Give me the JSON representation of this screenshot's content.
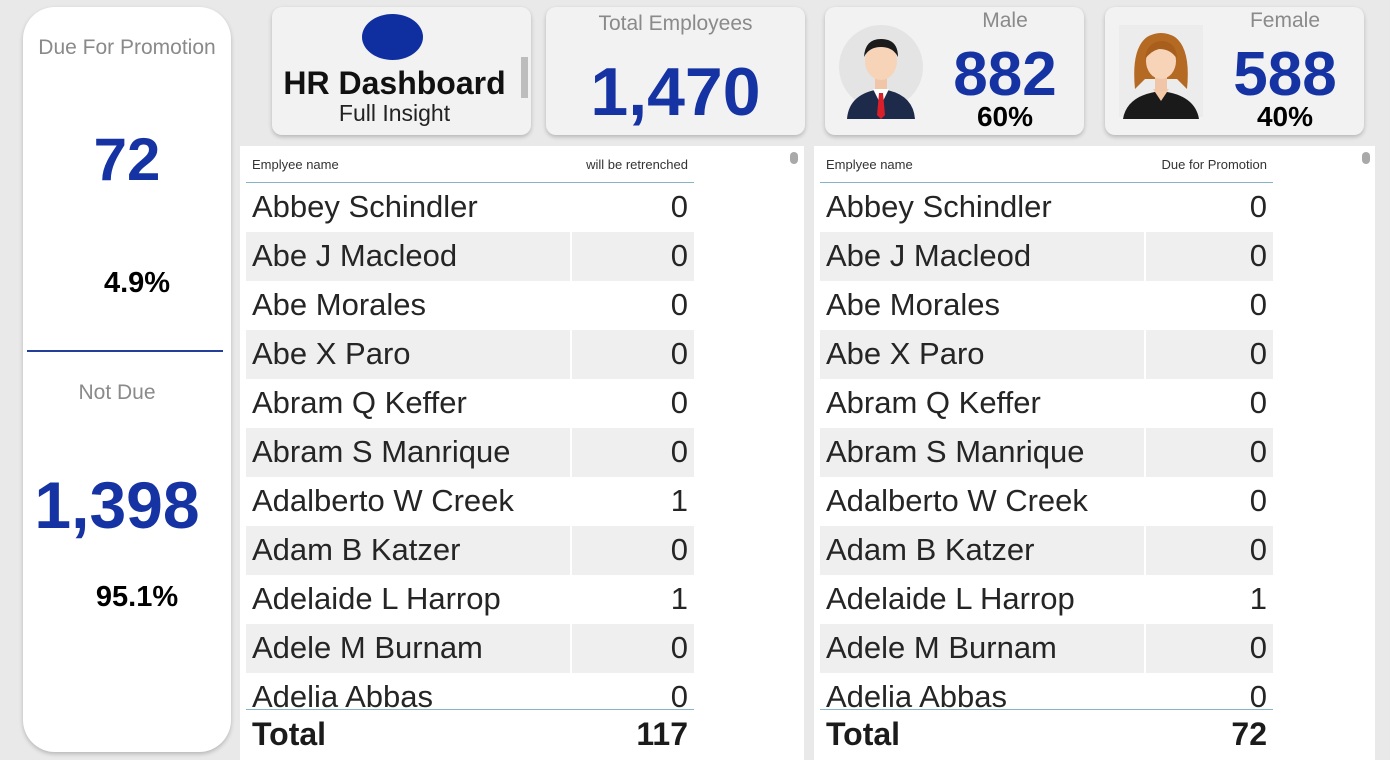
{
  "promotion_card": {
    "title": "Due For Promotion",
    "due_count": "72",
    "due_pct": "4.9%",
    "not_due_label": "Not Due",
    "not_due_count": "1,398",
    "not_due_pct": "95.1%"
  },
  "title_card": {
    "title": "HR Dashboard",
    "subtitle": "Full Insight"
  },
  "total_card": {
    "label": "Total Employees",
    "value": "1,470"
  },
  "male_card": {
    "label": "Male",
    "value": "882",
    "pct": "60%"
  },
  "female_card": {
    "label": "Female",
    "value": "588",
    "pct": "40%"
  },
  "retrench_table": {
    "col_name": "Emplyee name",
    "col_value": "will be retrenched",
    "rows": [
      {
        "name": "Abbey Schindler",
        "value": "0"
      },
      {
        "name": "Abe J Macleod",
        "value": "0"
      },
      {
        "name": "Abe Morales",
        "value": "0"
      },
      {
        "name": "Abe X Paro",
        "value": "0"
      },
      {
        "name": "Abram Q Keffer",
        "value": "0"
      },
      {
        "name": "Abram S Manrique",
        "value": "0"
      },
      {
        "name": "Adalberto W Creek",
        "value": "1"
      },
      {
        "name": "Adam B Katzer",
        "value": "0"
      },
      {
        "name": "Adelaide L Harrop",
        "value": "1"
      },
      {
        "name": "Adele M Burnam",
        "value": "0"
      },
      {
        "name": "Adelia Abbas",
        "value": "0"
      }
    ],
    "total_label": "Total",
    "total_value": "117"
  },
  "promotion_table": {
    "col_name": "Emplyee name",
    "col_value": "Due for Promotion",
    "rows": [
      {
        "name": "Abbey Schindler",
        "value": "0"
      },
      {
        "name": "Abe J Macleod",
        "value": "0"
      },
      {
        "name": "Abe Morales",
        "value": "0"
      },
      {
        "name": "Abe X Paro",
        "value": "0"
      },
      {
        "name": "Abram Q Keffer",
        "value": "0"
      },
      {
        "name": "Abram S Manrique",
        "value": "0"
      },
      {
        "name": "Adalberto W Creek",
        "value": "0"
      },
      {
        "name": "Adam B Katzer",
        "value": "0"
      },
      {
        "name": "Adelaide L Harrop",
        "value": "1"
      },
      {
        "name": "Adele M Burnam",
        "value": "0"
      },
      {
        "name": "Adelia Abbas",
        "value": "0"
      }
    ],
    "total_label": "Total",
    "total_value": "72"
  },
  "icons": {
    "male_avatar": "male-avatar-icon",
    "female_avatar": "female-avatar-icon",
    "logo": "logo-circle-icon"
  },
  "colors": {
    "accent_blue": "#1533a3",
    "logo_blue": "#0f2fa0"
  }
}
